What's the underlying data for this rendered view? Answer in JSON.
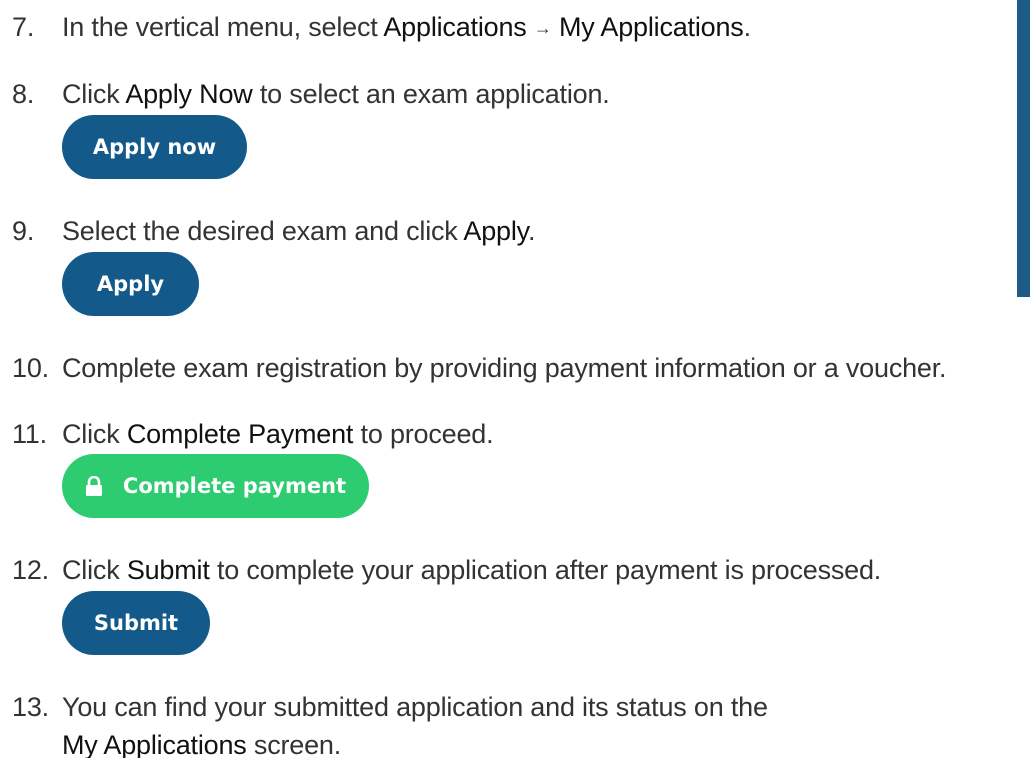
{
  "steps": [
    {
      "number": "7.",
      "text_a": "In the vertical menu, select ",
      "bold_a": "Applications",
      "arrow": "→",
      "bold_b": "My Applications",
      "text_b": "."
    },
    {
      "number": "8.",
      "text_a": "Click ",
      "bold_a": "Apply Now",
      "text_b": " to select an exam application."
    },
    {
      "number": "9.",
      "text_a": "Select the desired exam and click ",
      "bold_a": "Apply",
      "text_b": "."
    },
    {
      "number": "10.",
      "text_a": "Complete exam registration by providing payment information or a voucher."
    },
    {
      "number": "11.",
      "text_a": "Click ",
      "bold_a": "Complete Payment",
      "text_b": " to proceed."
    },
    {
      "number": "12.",
      "text_a": "Click ",
      "bold_a": "Submit",
      "text_b": " to complete your application after payment is processed."
    },
    {
      "number": "13.",
      "text_a": "You can find your submitted application and its status on the",
      "bold_a": "My Applications",
      "text_b": " screen."
    }
  ],
  "buttons": {
    "apply_now": "Apply now",
    "apply": "Apply",
    "complete_payment": "Complete payment",
    "submit": "Submit"
  },
  "icons": {
    "complete_payment": "lock-icon"
  },
  "colors": {
    "primary_button": "#135a8a",
    "payment_button": "#2ecc71",
    "side_strip": "#1d5a86"
  }
}
